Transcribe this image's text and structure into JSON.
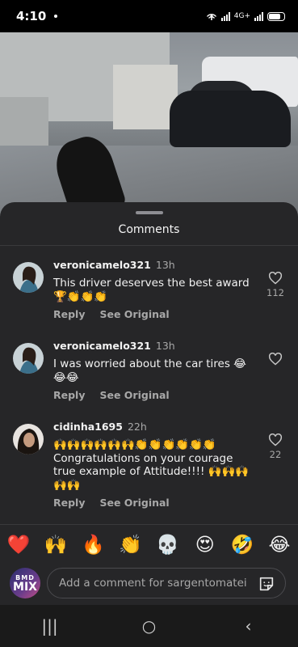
{
  "status_bar": {
    "time": "4:10",
    "network": "4G+"
  },
  "sheet": {
    "title": "Comments"
  },
  "comments": [
    {
      "username": "veronicamelo321",
      "time": "13h",
      "text": "This driver deserves the best award 🏆👏👏👏",
      "reply": "Reply",
      "see_original": "See Original",
      "likes": "112"
    },
    {
      "username": "veronicamelo321",
      "time": "13h",
      "text": "I was worried about the car tires 😂😂😂",
      "reply": "Reply",
      "see_original": "See Original",
      "likes": ""
    },
    {
      "username": "cidinha1695",
      "time": "22h",
      "text": "🙌🙌🙌🙌🙌🙌👏👏👏👏👏👏 Congratulations on your courage true example of Attitude!!!! 🙌🙌🙌🙌🙌",
      "reply": "Reply",
      "see_original": "See Original",
      "likes": "22"
    }
  ],
  "emojis": [
    "❤️",
    "🙌",
    "🔥",
    "👏",
    "💀",
    "😍",
    "🤣",
    "😂"
  ],
  "composer": {
    "placeholder": "Add a comment for sargentomatei",
    "avatar_line1": "BMD",
    "avatar_line2": "MIX"
  },
  "nav": {
    "recents": "|||",
    "home": "○",
    "back": "‹"
  },
  "colors": {
    "sheet_bg": "#262628",
    "text": "#f2f2f2",
    "muted": "#a8a8a8"
  }
}
